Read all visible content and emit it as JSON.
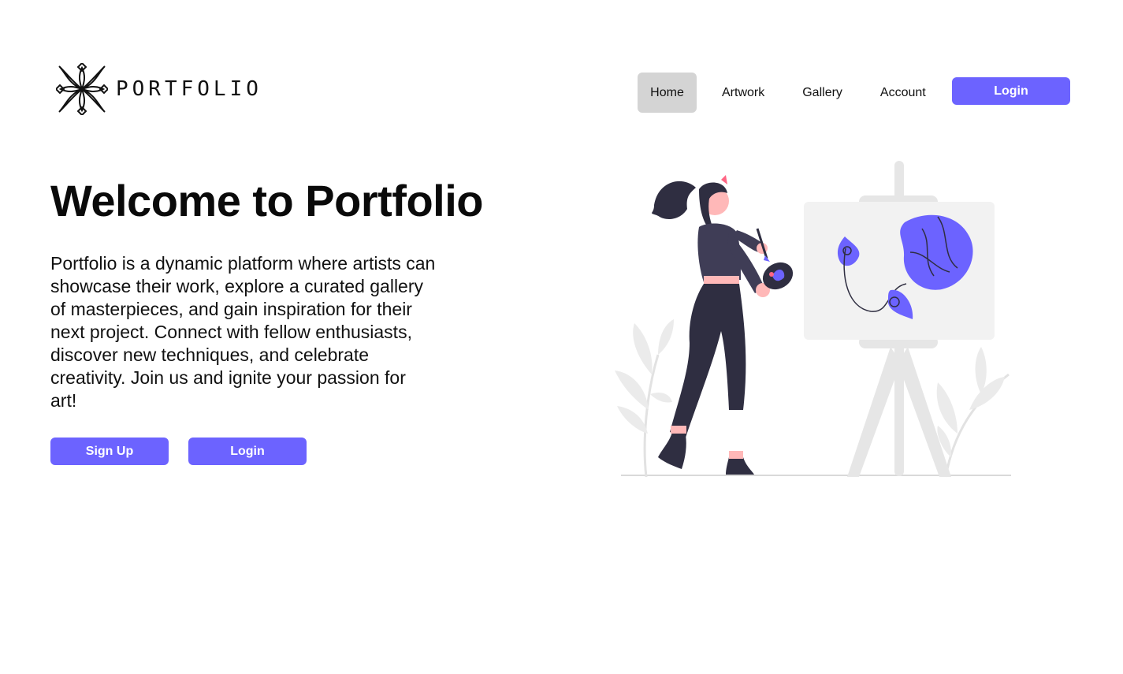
{
  "brand": {
    "name": "PORTFOLIO",
    "logo_icon": "flower-ornament-icon"
  },
  "nav": {
    "items": [
      {
        "label": "Home",
        "active": true
      },
      {
        "label": "Artwork",
        "active": false
      },
      {
        "label": "Gallery",
        "active": false
      },
      {
        "label": "Account",
        "active": false
      }
    ],
    "login_label": "Login"
  },
  "hero": {
    "title": "Welcome to Portfolio",
    "description": "Portfolio is a dynamic platform where artists can showcase their work, explore a curated gallery of masterpieces, and gain inspiration for their next project. Connect with fellow enthusiasts, discover new techniques, and celebrate creativity. Join us and ignite your passion for art!",
    "signup_label": "Sign Up",
    "login_label": "Login",
    "illustration": "artist-painting-easel-illustration"
  },
  "colors": {
    "accent": "#6c63ff",
    "nav_active_bg": "#d4d4d4",
    "text": "#111111"
  }
}
